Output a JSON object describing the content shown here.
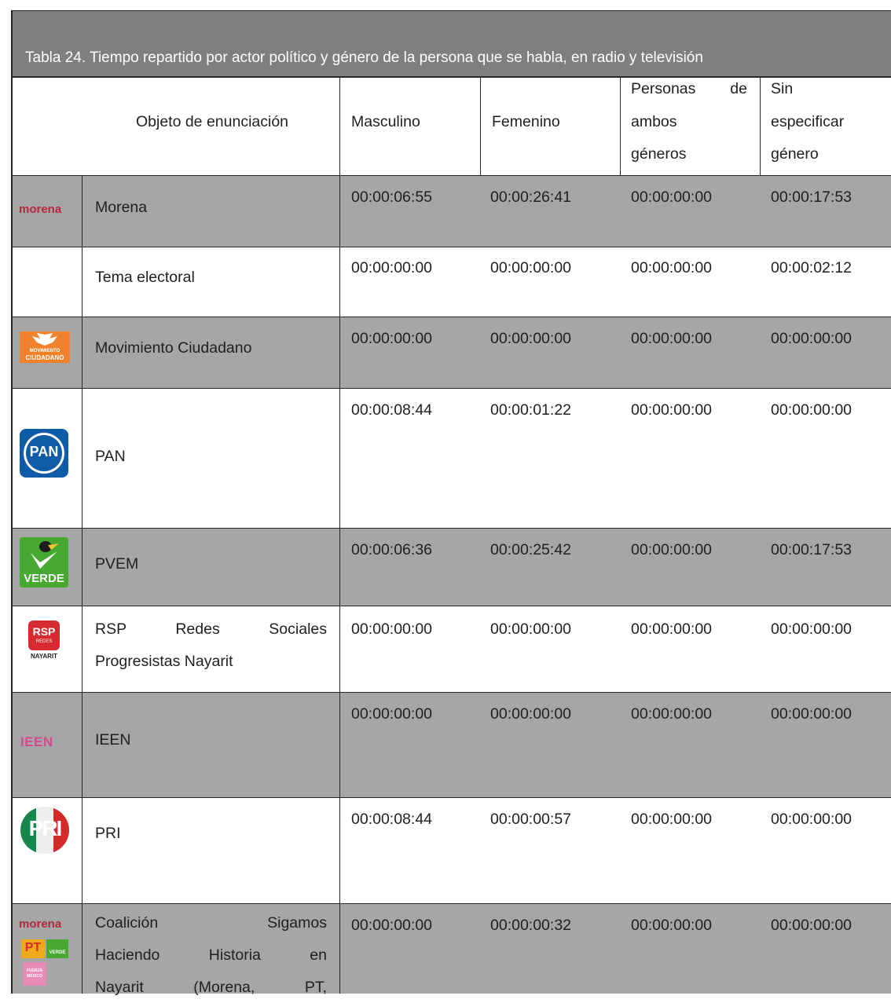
{
  "caption": "Tabla 24. Tiempo repartido por actor político y género de la persona que se habla, en radio y televisión",
  "headers": {
    "object": "Objeto de enunciación",
    "masculino": "Masculino",
    "femenino": "Femenino",
    "ambos_1": "Personas de",
    "ambos_2": "ambos",
    "ambos_3": "géneros",
    "sin_1": "Sin",
    "sin_2": "especificar",
    "sin_3": "género"
  },
  "logos": {
    "morena": "morena",
    "mc_1": "MOVIMIENTO",
    "mc_2": "CIUDADANO",
    "pan": "PAN",
    "verde": "VERDE",
    "rsp_1": "RSP",
    "rsp_2": "REDES",
    "rsp_3": "NAYARIT",
    "ieen": "IEEN",
    "pri": "PRI",
    "coal_morena": "morena",
    "coal_pt": "PT",
    "coal_verde": "VERDE",
    "coal_fxm": "FUERZA MÉXICO"
  },
  "rows": [
    {
      "name": "Morena",
      "m": "00:00:06:55",
      "f": "00:00:26:41",
      "a": "00:00:00:00",
      "s": "00:00:17:53"
    },
    {
      "name": "Tema electoral",
      "m": "00:00:00:00",
      "f": "00:00:00:00",
      "a": "00:00:00:00",
      "s": "00:00:02:12"
    },
    {
      "name": "Movimiento Ciudadano",
      "m": "00:00:00:00",
      "f": "00:00:00:00",
      "a": "00:00:00:00",
      "s": "00:00:00:00"
    },
    {
      "name": "PAN",
      "m": "00:00:08:44",
      "f": "00:00:01:22",
      "a": "00:00:00:00",
      "s": "00:00:00:00"
    },
    {
      "name": "PVEM",
      "m": "00:00:06:36",
      "f": "00:00:25:42",
      "a": "00:00:00:00",
      "s": "00:00:17:53"
    },
    {
      "name_1": "RSP Redes Sociales",
      "name_2": "Progresistas Nayarit",
      "m": "00:00:00:00",
      "f": "00:00:00:00",
      "a": "00:00:00:00",
      "s": "00:00:00:00"
    },
    {
      "name": "IEEN",
      "m": "00:00:00:00",
      "f": "00:00:00:00",
      "a": "00:00:00:00",
      "s": "00:00:00:00"
    },
    {
      "name": "PRI",
      "m": "00:00:08:44",
      "f": "00:00:00:57",
      "a": "00:00:00:00",
      "s": "00:00:00:00"
    },
    {
      "name_1": "Coalición Sigamos",
      "name_2": "Haciendo Historia en",
      "name_3": "Nayarit (Morena, PT,",
      "m": "00:00:00:00",
      "f": "00:00:00:32",
      "a": "00:00:00:00",
      "s": "00:00:00:00"
    }
  ],
  "colors": {
    "caption_bg": "#7f7f7f",
    "row_gray": "#a6a6a6",
    "morena": "#b5273a",
    "mc_orange": "#f0822d",
    "pan_blue": "#0f5ba8",
    "verde_green": "#47a832",
    "rsp_red": "#d62a30",
    "ieen_pink": "#cf4d8e",
    "pri_green": "#17864a",
    "pri_red": "#d42a2a"
  }
}
